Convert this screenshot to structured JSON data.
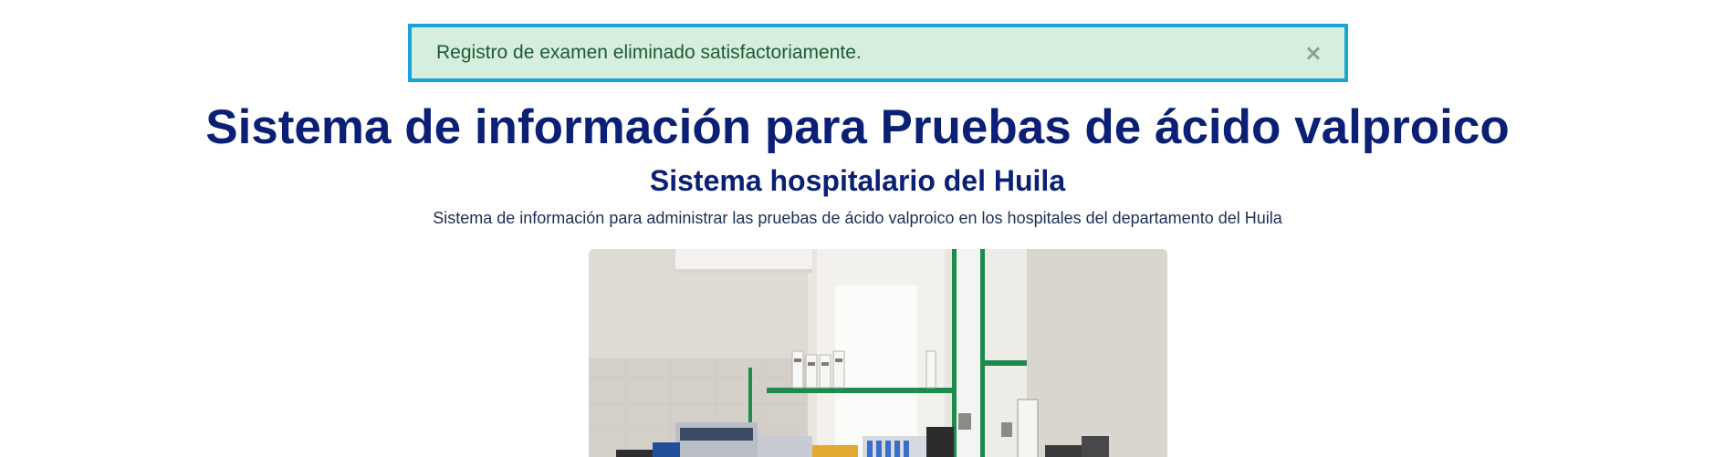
{
  "alert": {
    "message": "Registro de examen eliminado satisfactoriamente.",
    "close_symbol": "×",
    "border_color": "#1aa3d9",
    "background_color": "#d5eedd"
  },
  "header": {
    "title": "Sistema de información para Pruebas de ácido valproico",
    "subtitle": "Sistema hospitalario del Huila",
    "description": "Sistema de información para administrar las pruebas de ácido valproico en los hospitales del departamento del Huila"
  },
  "hero": {
    "icon": "laboratory-photo"
  },
  "colors": {
    "title": "#0b1f75",
    "accent_green": "#1e8a4c"
  }
}
